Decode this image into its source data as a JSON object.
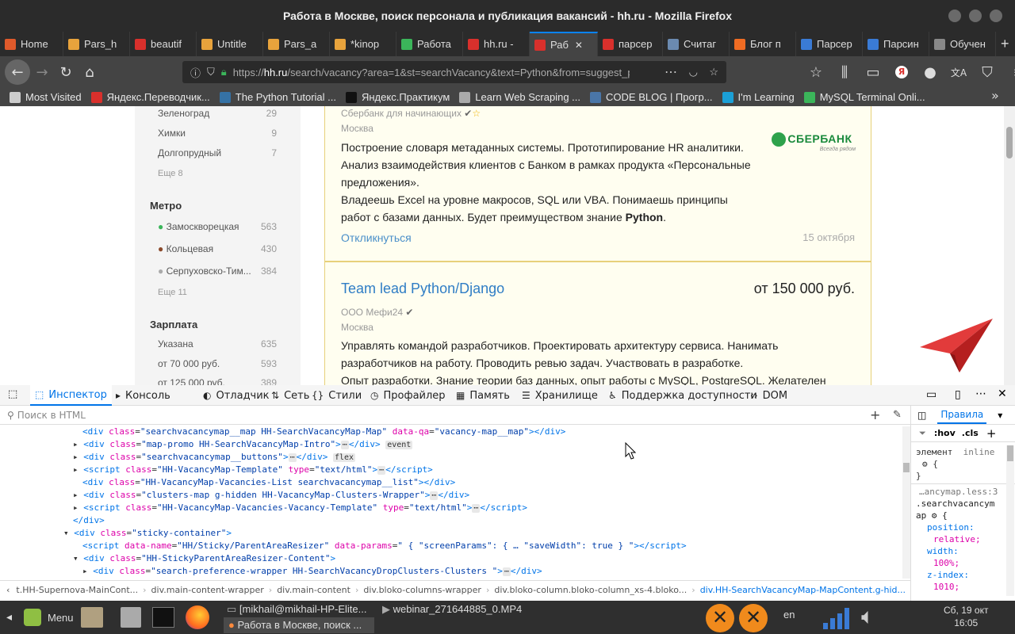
{
  "window": {
    "title": "Работа в Москве, поиск персонала и публикация вакансий - hh.ru - Mozilla Firefox"
  },
  "tabs": [
    {
      "label": "Home",
      "color": "#e05a2b"
    },
    {
      "label": "Pars_h",
      "color": "#e8a33c"
    },
    {
      "label": "beautif",
      "color": "#d9302c"
    },
    {
      "label": "Untitle",
      "color": "#e8a33c"
    },
    {
      "label": "Pars_a",
      "color": "#e8a33c"
    },
    {
      "label": "*kinop",
      "color": "#e8a33c"
    },
    {
      "label": "Работа",
      "color": "#3bb55a"
    },
    {
      "label": "hh.ru -",
      "color": "#d9302c"
    },
    {
      "label": "Раб",
      "color": "#d9302c"
    },
    {
      "label": "парсер",
      "color": "#d9302c"
    },
    {
      "label": "Считаг",
      "color": "#6b8ab0"
    },
    {
      "label": "Блог п",
      "color": "#f06c23"
    },
    {
      "label": "Парсер",
      "color": "#3a7bd5"
    },
    {
      "label": "Парсин",
      "color": "#3a7bd5"
    },
    {
      "label": "Обучен",
      "color": "#888888"
    }
  ],
  "url": {
    "prefix": "https://",
    "host": "hh.ru",
    "path": "/search/vacancy?area=1&st=searchVacancy&text=Python&from=suggest_po"
  },
  "bookmarks": [
    {
      "label": "Most Visited",
      "color": "#cccccc"
    },
    {
      "label": "Яндекс.Переводчик...",
      "color": "#d9302c"
    },
    {
      "label": "The Python Tutorial ...",
      "color": "#3572a5"
    },
    {
      "label": "Яндекс.Практикум",
      "color": "#111111"
    },
    {
      "label": "Learn Web Scraping ...",
      "color": "#aaaaaa"
    },
    {
      "label": "CODE BLOG | Прогр...",
      "color": "#4a76a8"
    },
    {
      "label": "I'm Learning",
      "color": "#1ba0d7"
    },
    {
      "label": "MySQL Terminal Onli...",
      "color": "#3bb55a"
    }
  ],
  "filters": {
    "cities": [
      {
        "name": "Зеленоград",
        "count": "29"
      },
      {
        "name": "Химки",
        "count": "9"
      },
      {
        "name": "Долгопрудный",
        "count": "7"
      }
    ],
    "cities_more": "Еще 8",
    "metro_title": "Метро",
    "metro": [
      {
        "name": "Замоскворецкая",
        "count": "563",
        "color": "#3bb55a"
      },
      {
        "name": "Кольцевая",
        "count": "430",
        "color": "#8b4a2b"
      },
      {
        "name": "Серпуховско-Тим...",
        "count": "384",
        "color": "#aaaaaa"
      }
    ],
    "metro_more": "Еще 11",
    "salary_title": "Зарплата",
    "salary": [
      {
        "name": "Указана",
        "count": "635"
      },
      {
        "name": "от 70 000 руб.",
        "count": "593"
      },
      {
        "name": "от 125 000 руб.",
        "count": "389"
      }
    ]
  },
  "vacancy1": {
    "company": "Сбербанк для начинающих",
    "city": "Москва",
    "desc1": "Построение словаря метаданных системы. Прототипирование HR аналитики.",
    "desc2": "Анализ взаимодействия клиентов с Банком в рамках продукта «Персональные",
    "desc3": "предложения».",
    "req1": "Владеешь Excel на уровне макросов, SQL или VBA. Понимаешь принципы",
    "req2": "работ с базами данных. Будет преимуществом знание",
    "req_bold": "Python",
    "respond": "Откликнуться",
    "date": "15 октября",
    "logo_text": "СБЕРБАНК",
    "logo_sub": "Всегда рядом"
  },
  "vacancy2": {
    "title": "Team lead Python/Django",
    "salary": "от 150 000 руб.",
    "company": "ООО Мефи24",
    "city": "Москва",
    "desc1": "Управлять командой разработчиков. Проектировать архитектуру сервиса. Нанимать",
    "desc2": "разработчиков на работу. Проводить ревью задач. Участвовать в разработке.",
    "req1": "Опыт разработки. Знание теории баз данных, опыт работы с MySQL, PostgreSQL. Желателен"
  },
  "devtools": {
    "tabs": [
      "Инспектор",
      "Консоль",
      "Отладчик",
      "Сеть",
      "Стили",
      "Профайлер",
      "Память",
      "Хранилище",
      "Поддержка доступности",
      "DOM"
    ],
    "search_placeholder": "Поиск в HTML",
    "rules_tab": "Правила",
    "hov": ":hov",
    "cls": ".cls",
    "rule1_sel": "элемент",
    "rule1_src": "inline",
    "rule1_brace": "{",
    "rule1_close": "}",
    "rule2_src": "…ancymap.less:3",
    "rule2_sel1": ".searchvacancym",
    "rule2_sel2": "ap",
    "rule2_brace": "{",
    "props": [
      {
        "name": "position:",
        "value": "relative;"
      },
      {
        "name": "width:",
        "value": "100%;"
      },
      {
        "name": "z-index:",
        "value": "1010;"
      }
    ],
    "breadcrumbs": [
      "t.HH-Supernova-MainCont...",
      "div.main-content-wrapper",
      "div.main-content",
      "div.bloko-columns-wrapper",
      "div.bloko-column.bloko-column_xs-4.bloko...",
      "div.HH-SearchVacancyMap-MapContent.g-hid..."
    ],
    "badge_event": "event",
    "badge_flex": "flex",
    "ellipsis": "⋯"
  },
  "taskbar": {
    "menu": "Menu",
    "task1": "[mikhail@mikhail-HP-Elite...",
    "task2": "webinar_271644885_0.MP4",
    "task3": "Работа в Москве, поиск ...",
    "lang": "en",
    "date": "Сб, 19 окт",
    "time": "16:05"
  }
}
